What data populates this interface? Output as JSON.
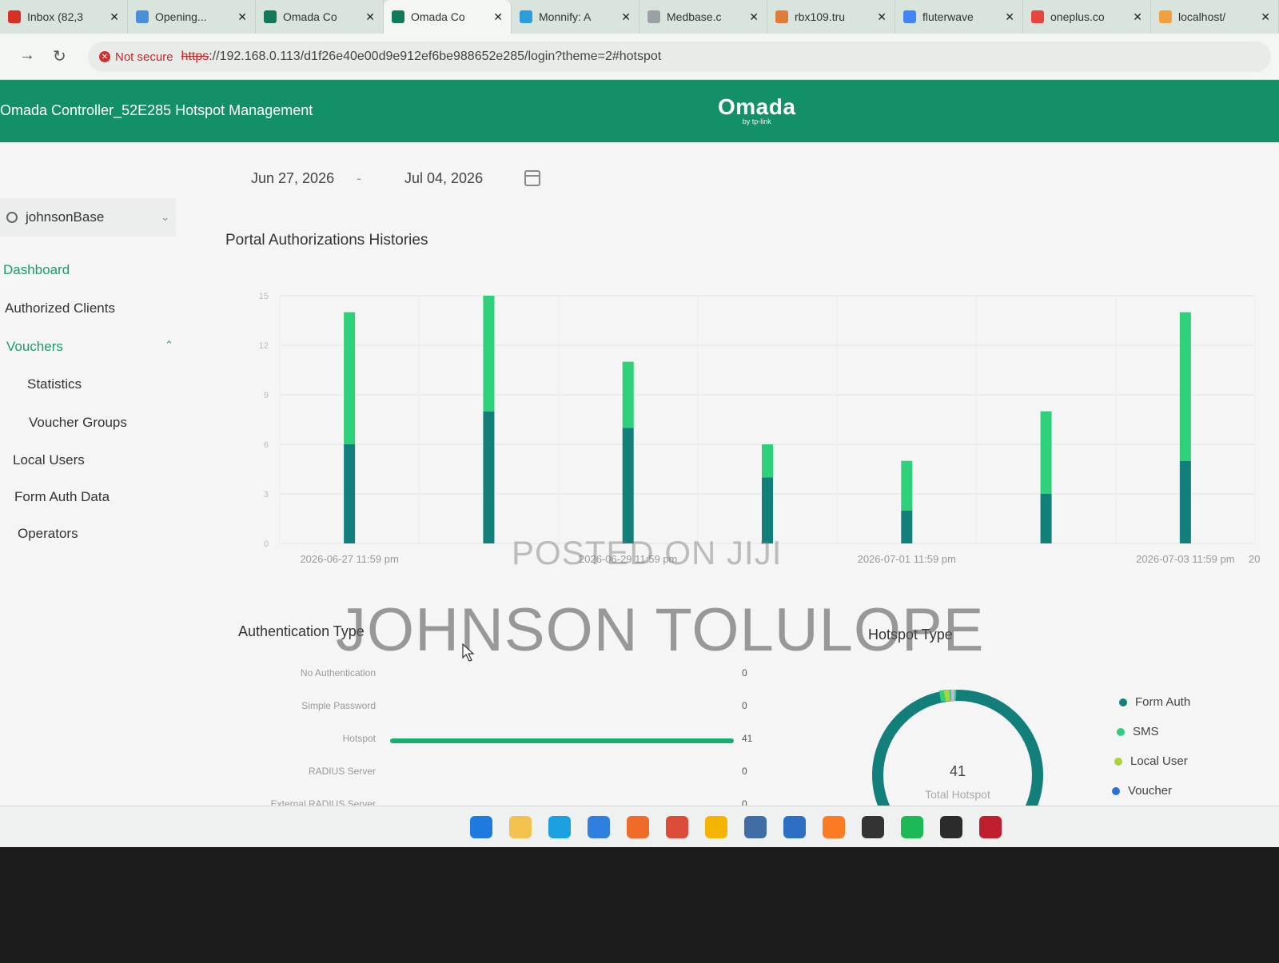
{
  "browser": {
    "tabs": [
      {
        "label": "Inbox (82,3",
        "color": "#d93025"
      },
      {
        "label": "Opening...",
        "color": "#4a90d9"
      },
      {
        "label": "Omada Co",
        "color": "#127a5a"
      },
      {
        "label": "Omada Co",
        "color": "#127a5a",
        "active": true
      },
      {
        "label": "Monnify: A",
        "color": "#2d9cdb"
      },
      {
        "label": "Medbase.c",
        "color": "#9aa0a6"
      },
      {
        "label": "rbx109.tru",
        "color": "#e07b39"
      },
      {
        "label": "fluterwave",
        "color": "#4285f4"
      },
      {
        "label": "oneplus.co",
        "color": "#e8453c"
      },
      {
        "label": "localhost/",
        "color": "#f2a03d"
      }
    ],
    "not_secure": "Not secure",
    "url_scheme": "https",
    "url_rest": "://192.168.0.113/d1f26e40e00d9e912ef6be988652e285/login?theme=2#hotspot"
  },
  "header": {
    "title": "Omada Controller_52E285 Hotspot Management",
    "logo": "Omada",
    "logo_sub": "by tp-link"
  },
  "date_range": {
    "start": "Jun 27, 2026",
    "separator": "-",
    "end": "Jul 04, 2026"
  },
  "sidebar": {
    "site": "johnsonBase",
    "items": [
      {
        "label": "Dashboard",
        "active": true
      },
      {
        "label": "Authorized Clients"
      },
      {
        "label": "Vouchers",
        "active": true
      },
      {
        "label": "Statistics"
      },
      {
        "label": "Voucher Groups"
      },
      {
        "label": "Local Users"
      },
      {
        "label": "Form Auth Data"
      },
      {
        "label": "Operators"
      }
    ]
  },
  "sections": {
    "portal": "Portal Authorizations Histories",
    "auth_type": "Authentication Type",
    "hotspot_type": "Hotspot Type"
  },
  "chart_data": [
    {
      "type": "bar",
      "title": "Portal Authorizations Histories",
      "stacked": true,
      "ylim": [
        0,
        15
      ],
      "yticks": [
        0,
        3,
        6,
        9,
        12,
        15
      ],
      "xlabels": [
        "2026-06-27 11:59 pm",
        "2026-06-29 11:59 pm",
        "2026-07-01 11:59 pm",
        "2026-07-03 11:59 pm",
        "20"
      ],
      "series": [
        {
          "color": "#137f7a",
          "values": [
            6,
            8,
            7,
            4,
            2,
            3,
            5
          ]
        },
        {
          "color": "#2ed07a",
          "values": [
            8,
            7,
            4,
            2,
            3,
            5,
            9
          ]
        }
      ],
      "grid": true
    },
    {
      "type": "bar",
      "title": "Authentication Type",
      "orientation": "horizontal",
      "categories": [
        "No Authentication",
        "Simple Password",
        "Hotspot",
        "RADIUS Server",
        "External RADIUS Server"
      ],
      "values": [
        0,
        0,
        41,
        0,
        0
      ],
      "color": "#14b06f"
    },
    {
      "type": "pie",
      "title": "Hotspot Type",
      "donut": true,
      "center_value": "41",
      "center_label": "Total Hotspot",
      "legend": [
        {
          "label": "Form Auth",
          "color": "#137f7a"
        },
        {
          "label": "SMS",
          "color": "#2ed07a"
        },
        {
          "label": "Local User",
          "color": "#a6d63a"
        },
        {
          "label": "Voucher",
          "color": "#2a6fdb"
        }
      ]
    }
  ],
  "watermarks": [
    "POSTED ON JIJI",
    "JOHNSON TOLULOPE"
  ],
  "taskbar": {
    "icons": [
      {
        "name": "windows-start-icon",
        "color": "#1f7ae0"
      },
      {
        "name": "file-explorer-icon",
        "color": "#f2c14e"
      },
      {
        "name": "edge-icon",
        "color": "#1ba1e2"
      },
      {
        "name": "vscode-icon",
        "color": "#2f7fe0"
      },
      {
        "name": "firefox-icon",
        "color": "#f06a2a"
      },
      {
        "name": "chrome-icon",
        "color": "#dd4b39"
      },
      {
        "name": "chrome-canary-icon",
        "color": "#f4b400"
      },
      {
        "name": "remote-desktop-icon",
        "color": "#3f6ea6"
      },
      {
        "name": "store-icon",
        "color": "#2d6fc4"
      },
      {
        "name": "xampp-icon",
        "color": "#fb7a24"
      },
      {
        "name": "inkscape-icon",
        "color": "#333333"
      },
      {
        "name": "spotify-icon",
        "color": "#1db954"
      },
      {
        "name": "terminal-icon",
        "color": "#2b2b2b"
      },
      {
        "name": "filezilla-icon",
        "color": "#bf1e2e"
      }
    ]
  }
}
